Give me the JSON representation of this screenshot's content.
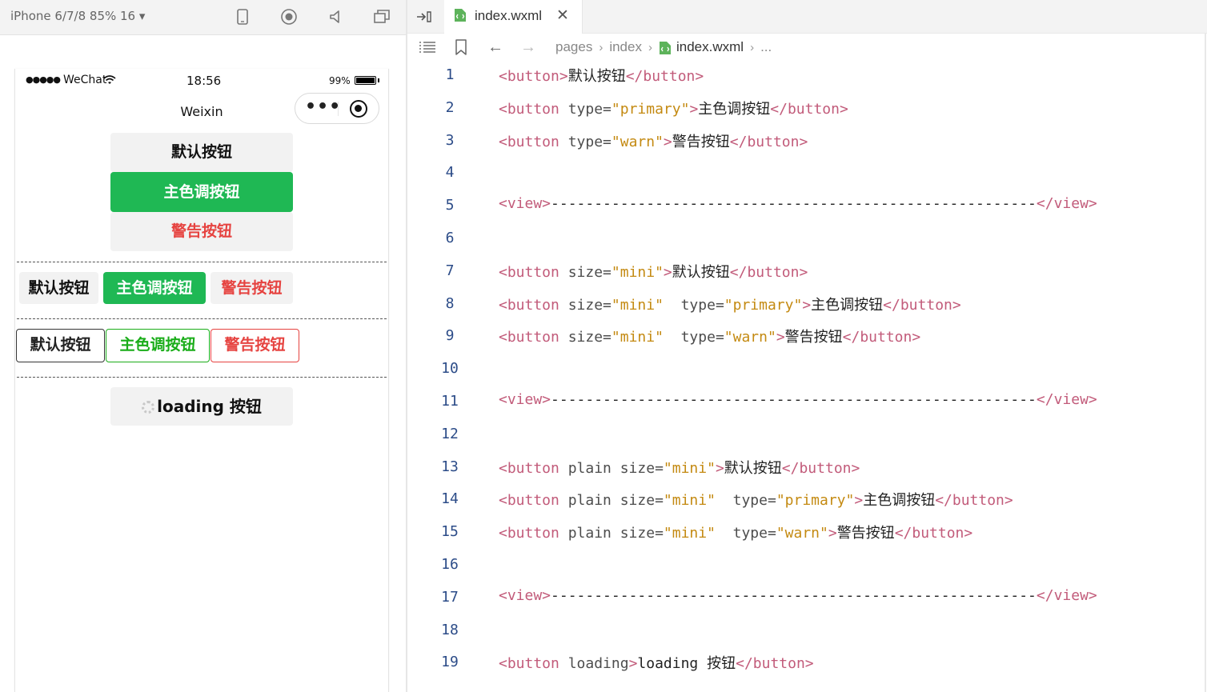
{
  "simulator": {
    "device_label": "iPhone 6/7/8 85% 16 ▾",
    "status": {
      "signal": "●●●●●",
      "carrier": "WeChat",
      "time": "18:56",
      "battery": "99%",
      "battery_level": 0.99
    },
    "nav_title": "Weixin",
    "buttons": {
      "default": "默认按钮",
      "primary": "主色调按钮",
      "warn": "警告按钮",
      "loading": "loading 按钮"
    }
  },
  "editor": {
    "tab_label": "index.wxml",
    "breadcrumb": [
      "pages",
      "index",
      "index.wxml",
      "..."
    ],
    "lines": [
      {
        "n": "1",
        "parts": [
          [
            "tg",
            "<button>"
          ],
          [
            "tx",
            "默认按钮"
          ],
          [
            "tg",
            "</button>"
          ]
        ]
      },
      {
        "n": "2",
        "parts": [
          [
            "tg",
            "<button "
          ],
          [
            "at",
            "type="
          ],
          [
            "st",
            "\"primary\""
          ],
          [
            "tg",
            ">"
          ],
          [
            "tx",
            "主色调按钮"
          ],
          [
            "tg",
            "</button>"
          ]
        ]
      },
      {
        "n": "3",
        "parts": [
          [
            "tg",
            "<button "
          ],
          [
            "at",
            "type="
          ],
          [
            "st",
            "\"warn\""
          ],
          [
            "tg",
            ">"
          ],
          [
            "tx",
            "警告按钮"
          ],
          [
            "tg",
            "</button>"
          ]
        ]
      },
      {
        "n": "4",
        "parts": []
      },
      {
        "n": "5",
        "parts": [
          [
            "tg",
            "<view>"
          ],
          [
            "tx",
            "--------------------------------------------------------"
          ],
          [
            "tg",
            "</view>"
          ]
        ]
      },
      {
        "n": "6",
        "parts": []
      },
      {
        "n": "7",
        "parts": [
          [
            "tg",
            "<button "
          ],
          [
            "at",
            "size="
          ],
          [
            "st",
            "\"mini\""
          ],
          [
            "tg",
            ">"
          ],
          [
            "tx",
            "默认按钮"
          ],
          [
            "tg",
            "</button>"
          ]
        ]
      },
      {
        "n": "8",
        "parts": [
          [
            "tg",
            "<button "
          ],
          [
            "at",
            "size="
          ],
          [
            "st",
            "\"mini\""
          ],
          [
            "at",
            "  type="
          ],
          [
            "st",
            "\"primary\""
          ],
          [
            "tg",
            ">"
          ],
          [
            "tx",
            "主色调按钮"
          ],
          [
            "tg",
            "</button>"
          ]
        ]
      },
      {
        "n": "9",
        "parts": [
          [
            "tg",
            "<button "
          ],
          [
            "at",
            "size="
          ],
          [
            "st",
            "\"mini\""
          ],
          [
            "at",
            "  type="
          ],
          [
            "st",
            "\"warn\""
          ],
          [
            "tg",
            ">"
          ],
          [
            "tx",
            "警告按钮"
          ],
          [
            "tg",
            "</button>"
          ]
        ]
      },
      {
        "n": "10",
        "parts": []
      },
      {
        "n": "11",
        "parts": [
          [
            "tg",
            "<view>"
          ],
          [
            "tx",
            "--------------------------------------------------------"
          ],
          [
            "tg",
            "</view>"
          ]
        ]
      },
      {
        "n": "12",
        "parts": []
      },
      {
        "n": "13",
        "parts": [
          [
            "tg",
            "<button "
          ],
          [
            "at",
            "plain size="
          ],
          [
            "st",
            "\"mini\""
          ],
          [
            "tg",
            ">"
          ],
          [
            "tx",
            "默认按钮"
          ],
          [
            "tg",
            "</button>"
          ]
        ]
      },
      {
        "n": "14",
        "parts": [
          [
            "tg",
            "<button "
          ],
          [
            "at",
            "plain size="
          ],
          [
            "st",
            "\"mini\""
          ],
          [
            "at",
            "  type="
          ],
          [
            "st",
            "\"primary\""
          ],
          [
            "tg",
            ">"
          ],
          [
            "tx",
            "主色调按钮"
          ],
          [
            "tg",
            "</button>"
          ]
        ]
      },
      {
        "n": "15",
        "parts": [
          [
            "tg",
            "<button "
          ],
          [
            "at",
            "plain size="
          ],
          [
            "st",
            "\"mini\""
          ],
          [
            "at",
            "  type="
          ],
          [
            "st",
            "\"warn\""
          ],
          [
            "tg",
            ">"
          ],
          [
            "tx",
            "警告按钮"
          ],
          [
            "tg",
            "</button>"
          ]
        ]
      },
      {
        "n": "16",
        "parts": []
      },
      {
        "n": "17",
        "parts": [
          [
            "tg",
            "<view>"
          ],
          [
            "tx",
            "--------------------------------------------------------"
          ],
          [
            "tg",
            "</view>"
          ]
        ]
      },
      {
        "n": "18",
        "parts": []
      },
      {
        "n": "19",
        "parts": [
          [
            "tg",
            "<button "
          ],
          [
            "at",
            "loading"
          ],
          [
            "tg",
            ">"
          ],
          [
            "tx",
            "loading 按钮"
          ],
          [
            "tg",
            "</button>"
          ]
        ]
      }
    ]
  },
  "colors": {
    "primary_green": "#1fb854",
    "warn_red": "#e64340",
    "tag_color": "#c25b7a",
    "string_color": "#c48a12",
    "line_number_color": "#2c4c88"
  },
  "icons": [
    "phone-icon",
    "record-icon",
    "volume-icon",
    "window-icon",
    "split-editor-icon",
    "file-icon",
    "close-icon",
    "outline-icon",
    "bookmark-icon",
    "back-arrow-icon",
    "forward-arrow-icon"
  ]
}
